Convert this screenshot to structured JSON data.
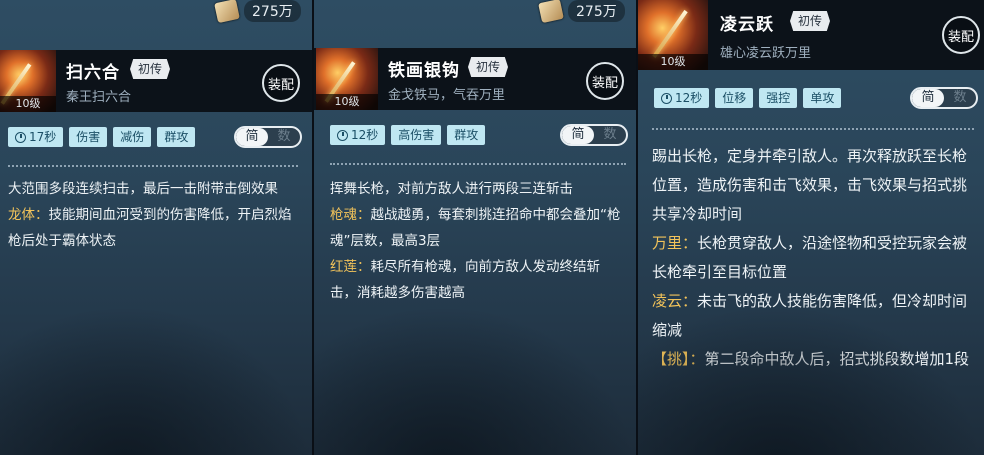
{
  "currency": {
    "icon": "scroll-coin-icon",
    "value": "275万"
  },
  "panels": [
    {
      "name": "扫六合",
      "badge": "初传",
      "subtitle": "秦王扫六合",
      "level": "10级",
      "equip": "装配",
      "cooldown": "17秒",
      "tags": [
        "伤害",
        "减伤",
        "群攻"
      ],
      "toggle": {
        "simple": "简",
        "detail": "数"
      },
      "intro": "大范围多段连续扫击，最后一击附带击倒效果",
      "effects": [
        {
          "key": "龙体：",
          "text": "技能期间血河受到的伤害降低，开启烈焰枪后处于霸体状态"
        }
      ]
    },
    {
      "name": "铁画银钩",
      "badge": "初传",
      "subtitle": "金戈铁马，气吞万里",
      "level": "10级",
      "equip": "装配",
      "cooldown": "12秒",
      "tags": [
        "高伤害",
        "群攻"
      ],
      "toggle": {
        "simple": "简",
        "detail": "数"
      },
      "intro": "挥舞长枪，对前方敌人进行两段三连斩击",
      "effects": [
        {
          "key": "枪魂：",
          "text": "越战越勇，每套刺挑连招命中都会叠加“枪魂”层数，最高3层"
        },
        {
          "key": "红莲：",
          "text": "耗尽所有枪魂，向前方敌人发动终结斩击，消耗越多伤害越高"
        }
      ]
    },
    {
      "name": "凌云跃",
      "badge": "初传",
      "subtitle": "雄心凌云跃万里",
      "level": "10级",
      "equip": "装配",
      "cooldown": "12秒",
      "tags": [
        "位移",
        "强控",
        "单攻"
      ],
      "toggle": {
        "simple": "简",
        "detail": "数"
      },
      "intro": "踢出长枪，定身并牵引敌人。再次释放跃至长枪位置，造成伤害和击飞效果，击飞效果与招式挑共享冷却时间",
      "effects": [
        {
          "key": "万里：",
          "text": "长枪贯穿敌人，沿途怪物和受控玩家会被长枪牵引至目标位置"
        },
        {
          "key": "凌云：",
          "text": "未击飞的敌人技能伤害降低，但冷却时间缩减"
        },
        {
          "key": "【挑】：",
          "text": "第二段命中敌人后，招式挑段数增加1段"
        }
      ]
    }
  ]
}
